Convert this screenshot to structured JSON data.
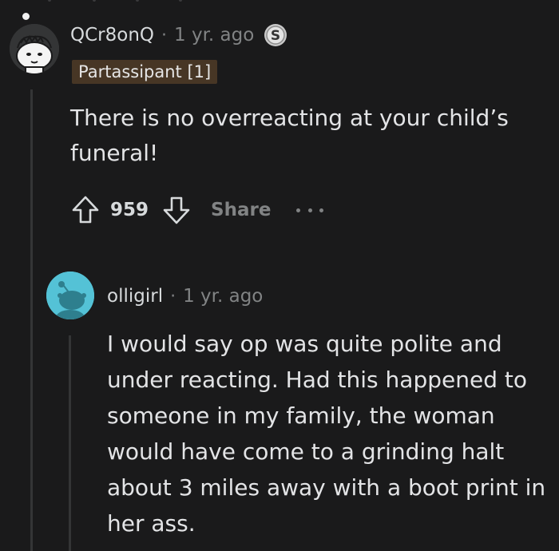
{
  "comment1": {
    "username": "QCr8onQ",
    "separator": "·",
    "time_ago": "1 yr. ago",
    "flair": "Partassipant [1]",
    "body": "There is no overreacting at your child’s funeral!",
    "score": "959",
    "share_label": "Share",
    "coin_icon": "silver-coin-icon"
  },
  "comment2": {
    "username": "olligirl",
    "separator": "·",
    "time_ago": "1 yr. ago",
    "body": "I would say op was quite polite and under reacting. Had this happened to someone in my family, the woman would have come to a grinding halt about 3 miles away with a boot print in her ass."
  },
  "colors": {
    "background": "#1a1a1b",
    "text": "#d7dadc",
    "muted": "#818384",
    "flair_bg": "#473625",
    "avatar2_bg": "#54c2d6"
  }
}
